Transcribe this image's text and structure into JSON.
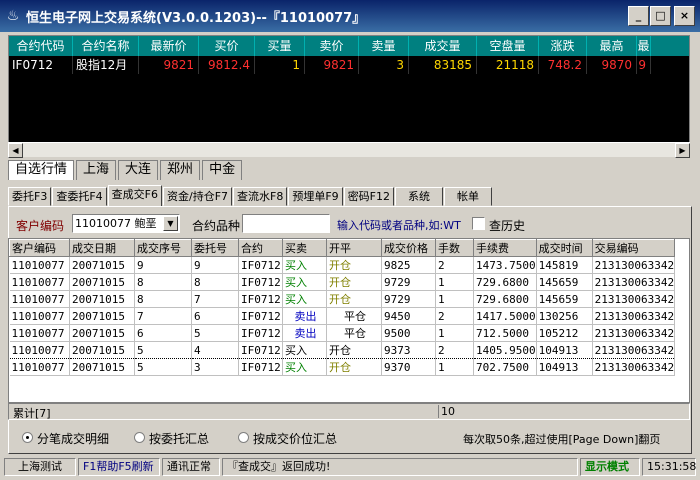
{
  "window": {
    "title": "恒生电子网上交易系统(V3.0.0.1203)--『11010077』",
    "min_btn": "_",
    "max_btn": "□",
    "close_btn": "×"
  },
  "quote": {
    "headers": [
      "合约代码",
      "合约名称",
      "最新价",
      "买价",
      "买量",
      "卖价",
      "卖量",
      "成交量",
      "空盘量",
      "涨跌",
      "最高",
      "最"
    ],
    "row": [
      "IF0712",
      "股指12月",
      "9821",
      "9812.4",
      "1",
      "9821",
      "3",
      "83185",
      "21118",
      "748.2",
      "9870",
      "9"
    ]
  },
  "market_tabs": [
    "自选行情",
    "上海",
    "大连",
    "郑州",
    "中金"
  ],
  "func_tabs": [
    "委托F3",
    "查委托F4",
    "查成交F6",
    "资金/持仓F7",
    "查流水F8",
    "预埋单F9",
    "密码F12",
    "系统",
    "帐单"
  ],
  "filter": {
    "cust_label": "客户编码",
    "cust_value": "11010077 鲍垩",
    "contract_label": "合约品种",
    "contract_value": "",
    "hint": "输入代码或者品种,如:WT",
    "history_label": "查历史"
  },
  "table": {
    "headers": [
      "客户编码",
      "成交日期",
      "成交序号",
      "委托号",
      "合约",
      "买卖",
      "开平",
      "成交价格",
      "手数",
      "手续费",
      "成交时间",
      "交易编码"
    ],
    "rows": [
      [
        "11010077",
        "20071015",
        "9",
        "9",
        "IF0712",
        "买入",
        "开仓",
        "9825",
        "2",
        "1473.7500",
        "145819",
        "213130063342"
      ],
      [
        "11010077",
        "20071015",
        "8",
        "8",
        "IF0712",
        "买入",
        "开仓",
        "9729",
        "1",
        "729.6800",
        "145659",
        "213130063342"
      ],
      [
        "11010077",
        "20071015",
        "8",
        "7",
        "IF0712",
        "买入",
        "开仓",
        "9729",
        "1",
        "729.6800",
        "145659",
        "213130063342"
      ],
      [
        "11010077",
        "20071015",
        "7",
        "6",
        "IF0712",
        "卖出",
        "平仓",
        "9450",
        "2",
        "1417.5000",
        "130256",
        "213130063342"
      ],
      [
        "11010077",
        "20071015",
        "6",
        "5",
        "IF0712",
        "卖出",
        "平仓",
        "9500",
        "1",
        "712.5000",
        "105212",
        "213130063342"
      ],
      [
        "11010077",
        "20071015",
        "5",
        "4",
        "IF0712",
        "买入",
        "开仓",
        "9373",
        "2",
        "1405.9500",
        "104913",
        "213130063342"
      ],
      [
        "11010077",
        "20071015",
        "5",
        "3",
        "IF0712",
        "买入",
        "开仓",
        "9370",
        "1",
        "702.7500",
        "104913",
        "213130063342"
      ]
    ]
  },
  "summary": {
    "label": "累计[7]",
    "count": "10"
  },
  "radios": [
    "分笔成交明细",
    "按委托汇总",
    "按成交价位汇总"
  ],
  "page_note": "每次取50条,超过使用[Page Down]翻页",
  "status": {
    "server": "上海测试",
    "help": "F1帮助F5刷新",
    "comm": "通讯正常",
    "msg": "『查成交』返回成功!",
    "mode": "显示模式",
    "time": "15:31:58"
  }
}
